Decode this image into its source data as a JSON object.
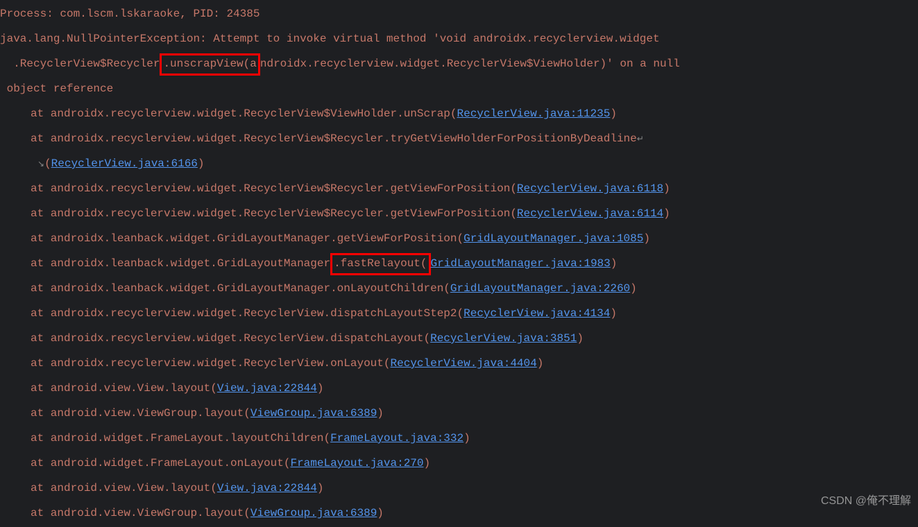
{
  "header": {
    "processLine": "Process: com.lscm.lskaraoke, PID: 24385",
    "exceptionPrefix": "java.lang.NullPointerException: Attempt to invoke virtual method 'void androidx.recyclerview.widget",
    "exceptionCont1a": "  .RecyclerView$Recycler",
    "exceptionBoxed1": ".unscrapView(a",
    "exceptionCont1b": "ndroidx.recyclerview.widget.RecyclerView$ViewHolder)' on a null",
    "exceptionCont2": " object reference"
  },
  "stack": [
    {
      "prefix": "at androidx.recyclerview.widget.RecyclerView$ViewHolder.unScrap(",
      "link": "RecyclerView.java:11235",
      "suffix": ")"
    },
    {
      "prefix": "at androidx.recyclerview.widget.RecyclerView$Recycler.tryGetViewHolderForPositionByDeadline",
      "link": "",
      "suffix": "",
      "wrap": true
    },
    {
      "prefix": "(",
      "link": "RecyclerView.java:6166",
      "suffix": ")",
      "isParen": true
    },
    {
      "prefix": "at androidx.recyclerview.widget.RecyclerView$Recycler.getViewForPosition(",
      "link": "RecyclerView.java:6118",
      "suffix": ")"
    },
    {
      "prefix": "at androidx.recyclerview.widget.RecyclerView$Recycler.getViewForPosition(",
      "link": "RecyclerView.java:6114",
      "suffix": ")"
    },
    {
      "prefix": "at androidx.leanback.widget.GridLayoutManager.getViewForPosition(",
      "link": "GridLayoutManager.java:1085",
      "suffix": ")"
    },
    {
      "prefix": "at androidx.leanback.widget.GridLayoutManager",
      "boxed": ".fastRelayout(",
      "link": "GridLayoutManager.java:1983",
      "suffix": ")"
    },
    {
      "prefix": "at androidx.leanback.widget.GridLayoutManager.onLayoutChildren(",
      "link": "GridLayoutManager.java:2260",
      "suffix": ")"
    },
    {
      "prefix": "at androidx.recyclerview.widget.RecyclerView.dispatchLayoutStep2(",
      "link": "RecyclerView.java:4134",
      "suffix": ")"
    },
    {
      "prefix": "at androidx.recyclerview.widget.RecyclerView.dispatchLayout(",
      "link": "RecyclerView.java:3851",
      "suffix": ")"
    },
    {
      "prefix": "at androidx.recyclerview.widget.RecyclerView.onLayout(",
      "link": "RecyclerView.java:4404",
      "suffix": ")"
    },
    {
      "prefix": "at android.view.View.layout(",
      "link": "View.java:22844",
      "suffix": ")"
    },
    {
      "prefix": "at android.view.ViewGroup.layout(",
      "link": "ViewGroup.java:6389",
      "suffix": ")"
    },
    {
      "prefix": "at android.widget.FrameLayout.layoutChildren(",
      "link": "FrameLayout.java:332",
      "suffix": ")"
    },
    {
      "prefix": "at android.widget.FrameLayout.onLayout(",
      "link": "FrameLayout.java:270",
      "suffix": ")"
    },
    {
      "prefix": "at android.view.View.layout(",
      "link": "View.java:22844",
      "suffix": ")"
    },
    {
      "prefix": "at android.view.ViewGroup.layout(",
      "link": "ViewGroup.java:6389",
      "suffix": ")"
    }
  ],
  "watermark": "CSDN @俺不理解",
  "wrapGlyph": "↵"
}
